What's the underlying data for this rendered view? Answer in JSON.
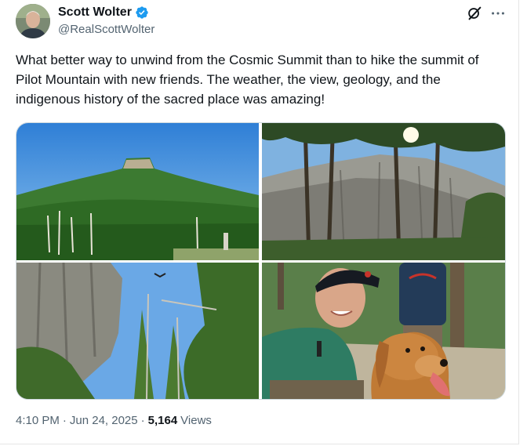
{
  "author": {
    "name": "Scott Wolter",
    "handle": "@RealScottWolter",
    "verified": true,
    "verified_color": "#1d9bf0"
  },
  "tweet": {
    "text": "What better way to unwind from the Cosmic Summit than to hike the summit of Pilot Mountain with new friends.  The weather, the view, geology, and the indigenous history of the sacred place was amazing!"
  },
  "media": {
    "photos": [
      {
        "subject": "pilot-mountain-knob"
      },
      {
        "subject": "rock-cliffs-and-pines"
      },
      {
        "subject": "cliff-face-and-trees"
      },
      {
        "subject": "selfie-with-golden-retriever"
      }
    ]
  },
  "meta": {
    "time": "4:10 PM",
    "separator": "·",
    "date": "Jun 24, 2025",
    "views_count": "5,164",
    "views_label": "Views"
  },
  "icons": {
    "grok": "grok-icon",
    "more": "more-icon",
    "verified": "verified-badge-icon"
  },
  "colors": {
    "text_primary": "#0f1419",
    "text_secondary": "#536471",
    "border": "#cfd9de"
  }
}
